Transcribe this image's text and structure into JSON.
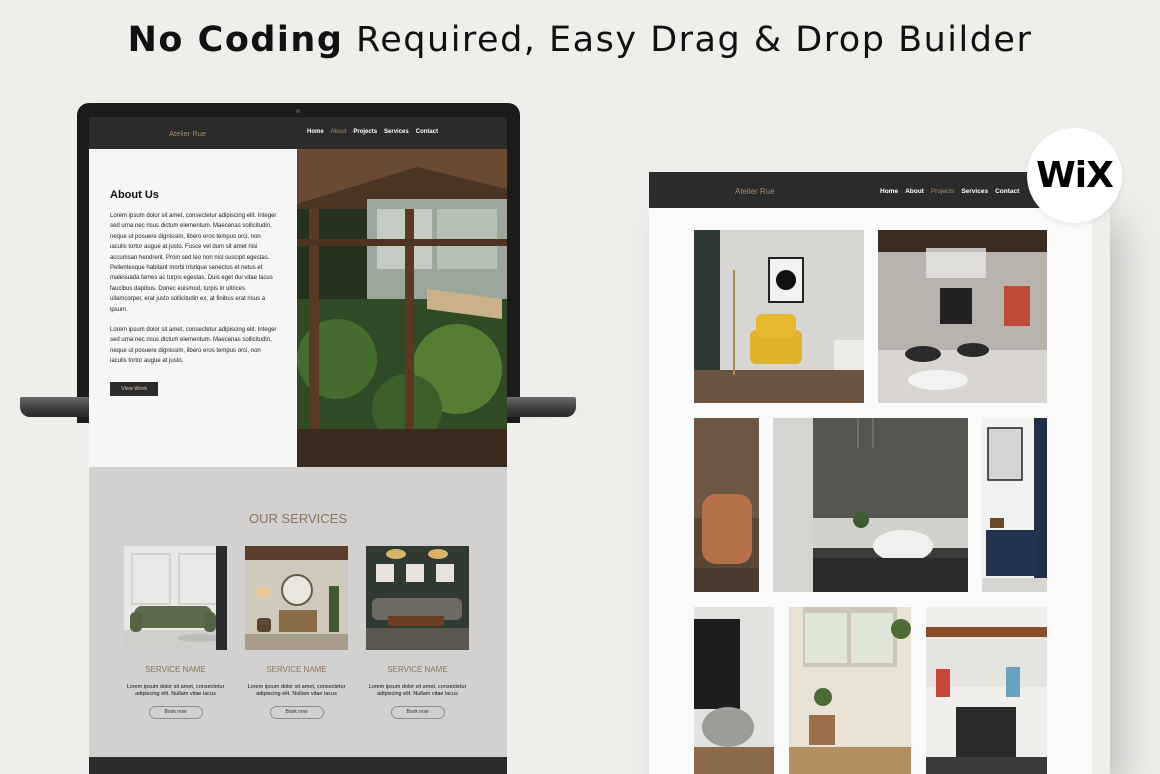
{
  "headline": {
    "bold": "No Coding",
    "rest": " Required, Easy Drag & Drop Builder"
  },
  "left_site": {
    "logo": "Atelier Rue",
    "menu": [
      "Home",
      "About",
      "Projects",
      "Services",
      "Contact"
    ],
    "hero": {
      "title": "About Us",
      "paragraph1": "Lorem ipsum dolor sit amet, consectetur adipiscing elit. Integer sed urna nec risus dictum elementum. Maecenas sollicitudin, neque ut posuere dignissim, libero eros tempus orci, non iaculis tortor augue at justo. Fusce vel dum sit amet nisi accumsan hendrerit. Proin sed leo non nisl suscipit egestas. Pellentesque habitant morbi tristique senectus et netus et malesuada fames ac turpis egestas. Duis eget dui vitae lacus faucibus dapibus. Donec euismod, turpis in ultrices ullamcorper, erat justo sollicitudin ex, at finibus erat risus a ipsum.",
      "paragraph2": "Lorem ipsum dolor sit amet, consectetur adipiscing elit. Integer sed urna nec risus dictum elementum. Maecenas sollicitudin, neque ut posuere dignissim, libero eros tempus orci, non iaculis tortor augue at justo.",
      "button": "View Work"
    },
    "services": {
      "title": "OUR SERVICES",
      "items": [
        {
          "name": "SERVICE NAME",
          "desc": "Lorem ipsum dolor sit amet, consectetur adipiscing elit. Nullam vitae lacus",
          "button": "Book now"
        },
        {
          "name": "SERVICE NAME",
          "desc": "Lorem ipsum dolor sit amet, consectetur adipiscing elit. Nullam vitae lacus",
          "button": "Book now"
        },
        {
          "name": "SERVICE NAME",
          "desc": "Lorem ipsum dolor sit amet, consectetur adipiscing elit. Nullam vitae lacus",
          "button": "Book now"
        }
      ]
    }
  },
  "right_site": {
    "logo": "Atelier Rue",
    "menu": [
      "Home",
      "About",
      "Projects",
      "Services",
      "Contact"
    ]
  },
  "badge": {
    "text": "WiX"
  },
  "colors": {
    "accent": "#a68d6a",
    "nav": "#2b2b2b",
    "services_bg": "#d2d1cf",
    "page_bg": "#efeeeb"
  }
}
